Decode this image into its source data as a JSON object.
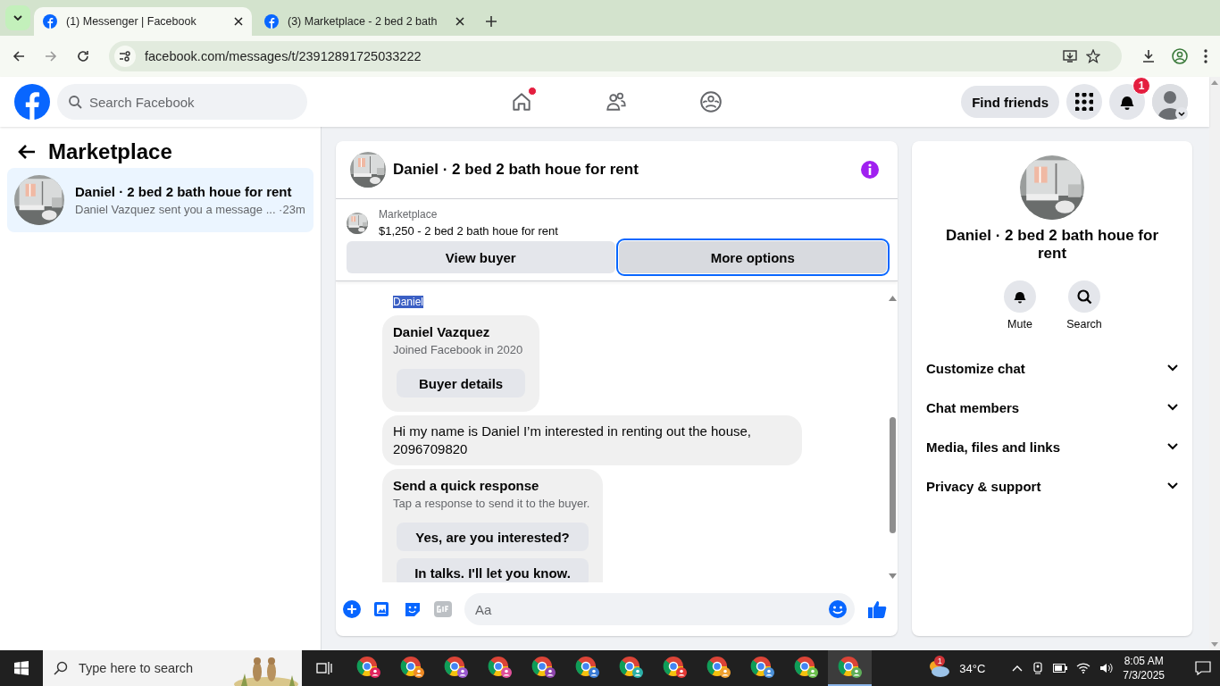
{
  "browser": {
    "tabs": [
      {
        "title": "(1) Messenger | Facebook",
        "selected": true
      },
      {
        "title": "(3) Marketplace - 2 bed 2 bath",
        "selected": false
      }
    ],
    "url": "facebook.com/messages/t/23912891725033222"
  },
  "header": {
    "search": {
      "placeholder": "Search Facebook"
    },
    "nav": [
      {
        "kind": "home",
        "selected": false,
        "dot": true
      },
      {
        "kind": "friends",
        "selected": false,
        "dot": false
      },
      {
        "kind": "groups",
        "selected": false,
        "dot": false
      }
    ],
    "find_friends": "Find friends",
    "notification_count": "1"
  },
  "sidebar": {
    "title": "Marketplace",
    "chats": [
      {
        "name": "Daniel · 2 bed 2 bath houe for rent",
        "preview": "Daniel Vazquez sent you a message ...",
        "time": "·23m",
        "selected": true
      }
    ]
  },
  "chat": {
    "title": "Daniel · 2 bed 2 bath houe for rent",
    "listing": {
      "label": "Marketplace",
      "text": "$1,250 - 2 bed 2 bath houe for rent"
    },
    "actions": [
      {
        "label": "View buyer",
        "focused": false
      },
      {
        "label": "More options",
        "focused": true
      }
    ],
    "sender": "Daniel",
    "profile_card": {
      "name": "Daniel Vazquez",
      "subtitle": "Joined Facebook in 2020",
      "button": "Buyer details"
    },
    "message": "Hi my name is Daniel I’m interested in renting out the house, 2096709820",
    "quick": {
      "title": "Send a quick response",
      "subtitle": "Tap a response to send it to the buyer.",
      "responses": [
        "Yes, are you interested?",
        "In talks. I'll let you know."
      ]
    },
    "composer": {
      "placeholder": "Aa"
    }
  },
  "info": {
    "title": "Daniel · 2 bed 2 bath houe for rent",
    "actions": [
      {
        "kind": "mute",
        "label": "Mute"
      },
      {
        "kind": "search",
        "label": "Search"
      }
    ],
    "sections": [
      {
        "label": "Customize chat",
        "expanded": false
      },
      {
        "label": "Chat members",
        "expanded": false
      },
      {
        "label": "Media, files and links",
        "expanded": false
      },
      {
        "label": "Privacy & support",
        "expanded": false
      }
    ]
  },
  "taskbar": {
    "search": {
      "placeholder": "Type here to search"
    },
    "apps": [
      {
        "color": "#e0245e",
        "selected": false
      },
      {
        "color": "#f08a24",
        "selected": false
      },
      {
        "color": "#9b59d0",
        "selected": false
      },
      {
        "color": "#e0509a",
        "selected": false
      },
      {
        "color": "#8e44ad",
        "selected": false
      },
      {
        "color": "#3a7bd5",
        "selected": false
      },
      {
        "color": "#2bb0a8",
        "selected": false
      },
      {
        "color": "#e53935",
        "selected": false
      },
      {
        "color": "#f0a030",
        "selected": false
      },
      {
        "color": "#4a90d9",
        "selected": false
      },
      {
        "color": "#6abf4b",
        "selected": false
      },
      {
        "color": "#5fae5a",
        "selected": true
      }
    ],
    "weather_badge": "1",
    "temperature": "34°C",
    "time": "8:05 AM",
    "date": "7/3/2025"
  }
}
